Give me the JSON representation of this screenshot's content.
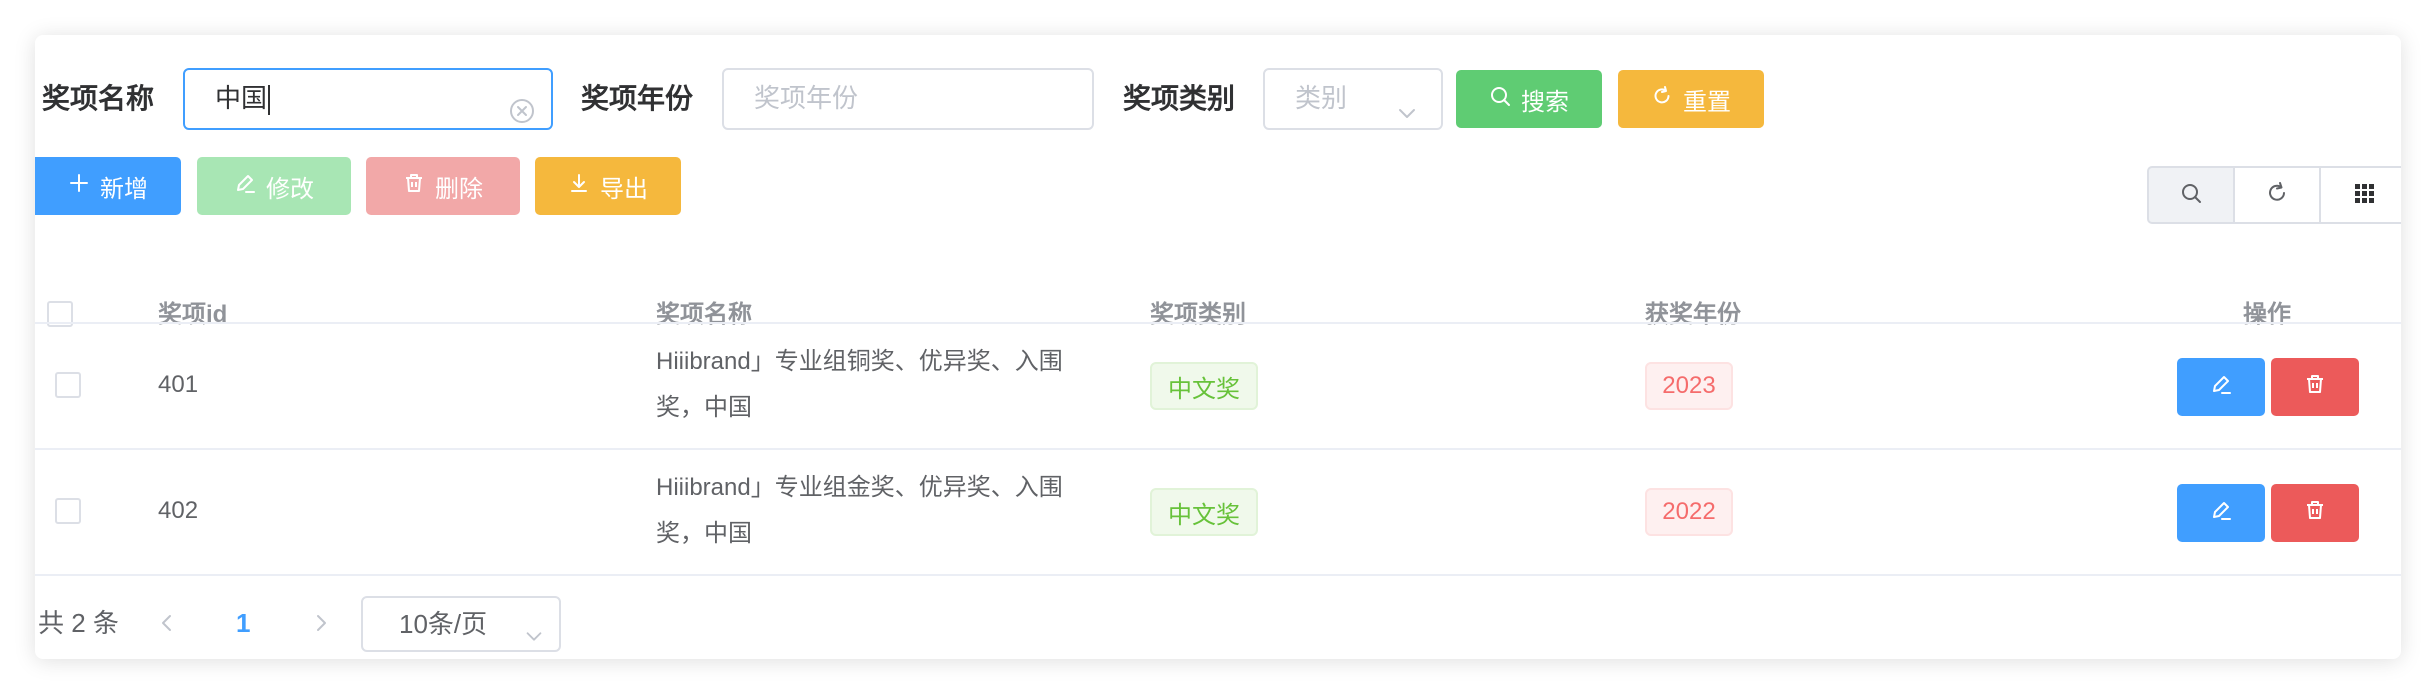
{
  "search_form": {
    "name_label": "奖项名称",
    "name_value": "中国",
    "year_label": "奖项年份",
    "year_placeholder": "奖项年份",
    "category_label": "奖项类别",
    "category_placeholder": "类别",
    "search_button": "搜索",
    "reset_button": "重置"
  },
  "toolbar": {
    "add_label": "新增",
    "edit_label": "修改",
    "delete_label": "删除",
    "export_label": "导出",
    "right_tools": [
      "search-icon",
      "refresh-icon",
      "grid-icon"
    ]
  },
  "table": {
    "columns": [
      "奖项id",
      "奖项名称",
      "奖项类别",
      "获奖年份",
      "操作"
    ],
    "rows": [
      {
        "id": "401",
        "name_line1": "Hiiibrand」专业组铜奖、优异奖、入围",
        "name_line2": "奖，中国",
        "category": "中文奖",
        "year": "2023"
      },
      {
        "id": "402",
        "name_line1": "Hiiibrand」专业组金奖、优异奖、入围",
        "name_line2": "奖，中国",
        "category": "中文奖",
        "year": "2022"
      }
    ]
  },
  "pagination": {
    "total_text": "共 2 条",
    "current_page": "1",
    "page_size": "10条/页"
  },
  "colors": {
    "primary": "#409eff",
    "success": "#5fcc73",
    "warning": "#f5b83d",
    "danger": "#ec5a5a"
  }
}
